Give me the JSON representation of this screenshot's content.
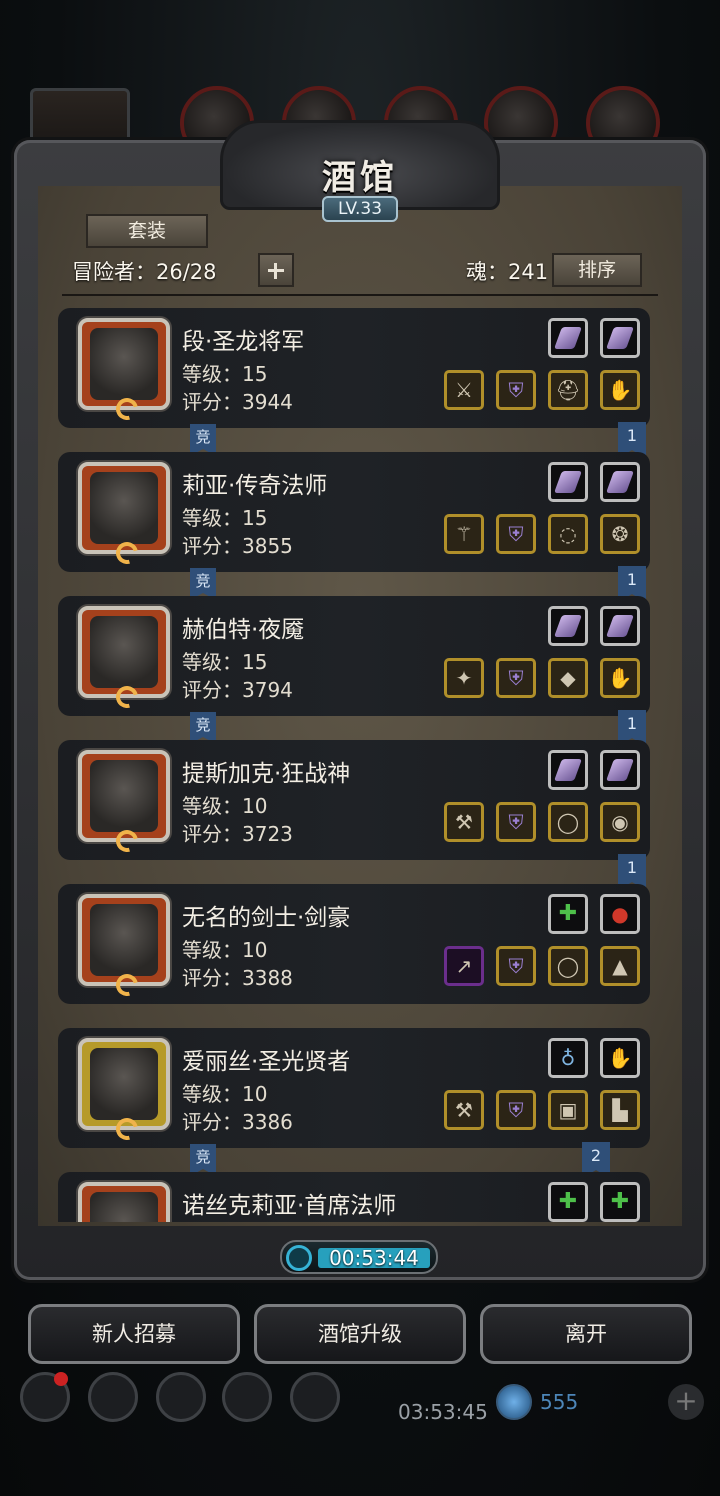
{
  "panel": {
    "title": "酒馆",
    "level": "LV.33",
    "suit_button": "套装",
    "adventurers": "冒险者：26/28",
    "soul": "魂：241",
    "sort_button": "排序"
  },
  "heroes": [
    {
      "name": "段·圣龙将军",
      "level": "等级：15",
      "score": "评分：3944",
      "badge_left": "竞",
      "badge_right": "1",
      "runes": [
        "gem",
        "gem"
      ],
      "equips": [
        "sword-icon",
        "armor-icon",
        "helmet-icon",
        "gauntlet-icon"
      ]
    },
    {
      "name": "莉亚·传奇法师",
      "level": "等级：15",
      "score": "评分：3855",
      "badge_left": "竞",
      "badge_right": "1",
      "runes": [
        "gem",
        "gem"
      ],
      "equips": [
        "staff-icon",
        "armor-icon",
        "necklace-icon",
        "amulet-icon"
      ]
    },
    {
      "name": "赫伯特·夜魇",
      "level": "等级：15",
      "score": "评分：3794",
      "badge_left": "竞",
      "badge_right": "1",
      "runes": [
        "gem",
        "gem"
      ],
      "equips": [
        "wand-icon",
        "armor-icon",
        "bracer-icon",
        "glove-icon"
      ]
    },
    {
      "name": "提斯加克·狂战神",
      "level": "等级：10",
      "score": "评分：3723",
      "badge_left": "",
      "badge_right": "1",
      "runes": [
        "gem",
        "gem"
      ],
      "equips": [
        "axe-icon",
        "armor-icon",
        "ring-icon",
        "ring-gem-icon"
      ]
    },
    {
      "name": "无名的剑士·剑豪",
      "level": "等级：10",
      "score": "评分：3388",
      "badge_left": "",
      "badge_right": "",
      "runes": [
        "star",
        "orb"
      ],
      "equips": [
        "spear-icon",
        "armor-icon",
        "ring-icon",
        "cloak-icon"
      ]
    },
    {
      "name": "爱丽丝·圣光贤者",
      "level": "等级：10",
      "score": "评分：3386",
      "badge_left": "竞",
      "badge_right": "2",
      "runes": [
        "pendant",
        "glove"
      ],
      "equips": [
        "hammer-icon",
        "armor-icon",
        "chest-icon",
        "boots-icon"
      ]
    },
    {
      "name": "诺丝克莉亚·首席法师",
      "level": "",
      "score": "",
      "badge_left": "",
      "badge_right": "",
      "runes": [
        "star",
        "star"
      ],
      "equips": []
    }
  ],
  "timer": "00:53:44",
  "buttons": {
    "recruit": "新人招募",
    "upgrade": "酒馆升级",
    "leave": "离开"
  },
  "hud": {
    "countdown": "03:53:45",
    "gems": "555"
  },
  "colors": {
    "panel_bg": "#4a4337",
    "card_bg": "#1e2024",
    "portrait_orange": "#a5411c",
    "portrait_gold": "#b69a29",
    "equip_border": "#b08f2a",
    "tag_blue": "#2f4f78",
    "timer_cyan": "#27a0bd"
  }
}
